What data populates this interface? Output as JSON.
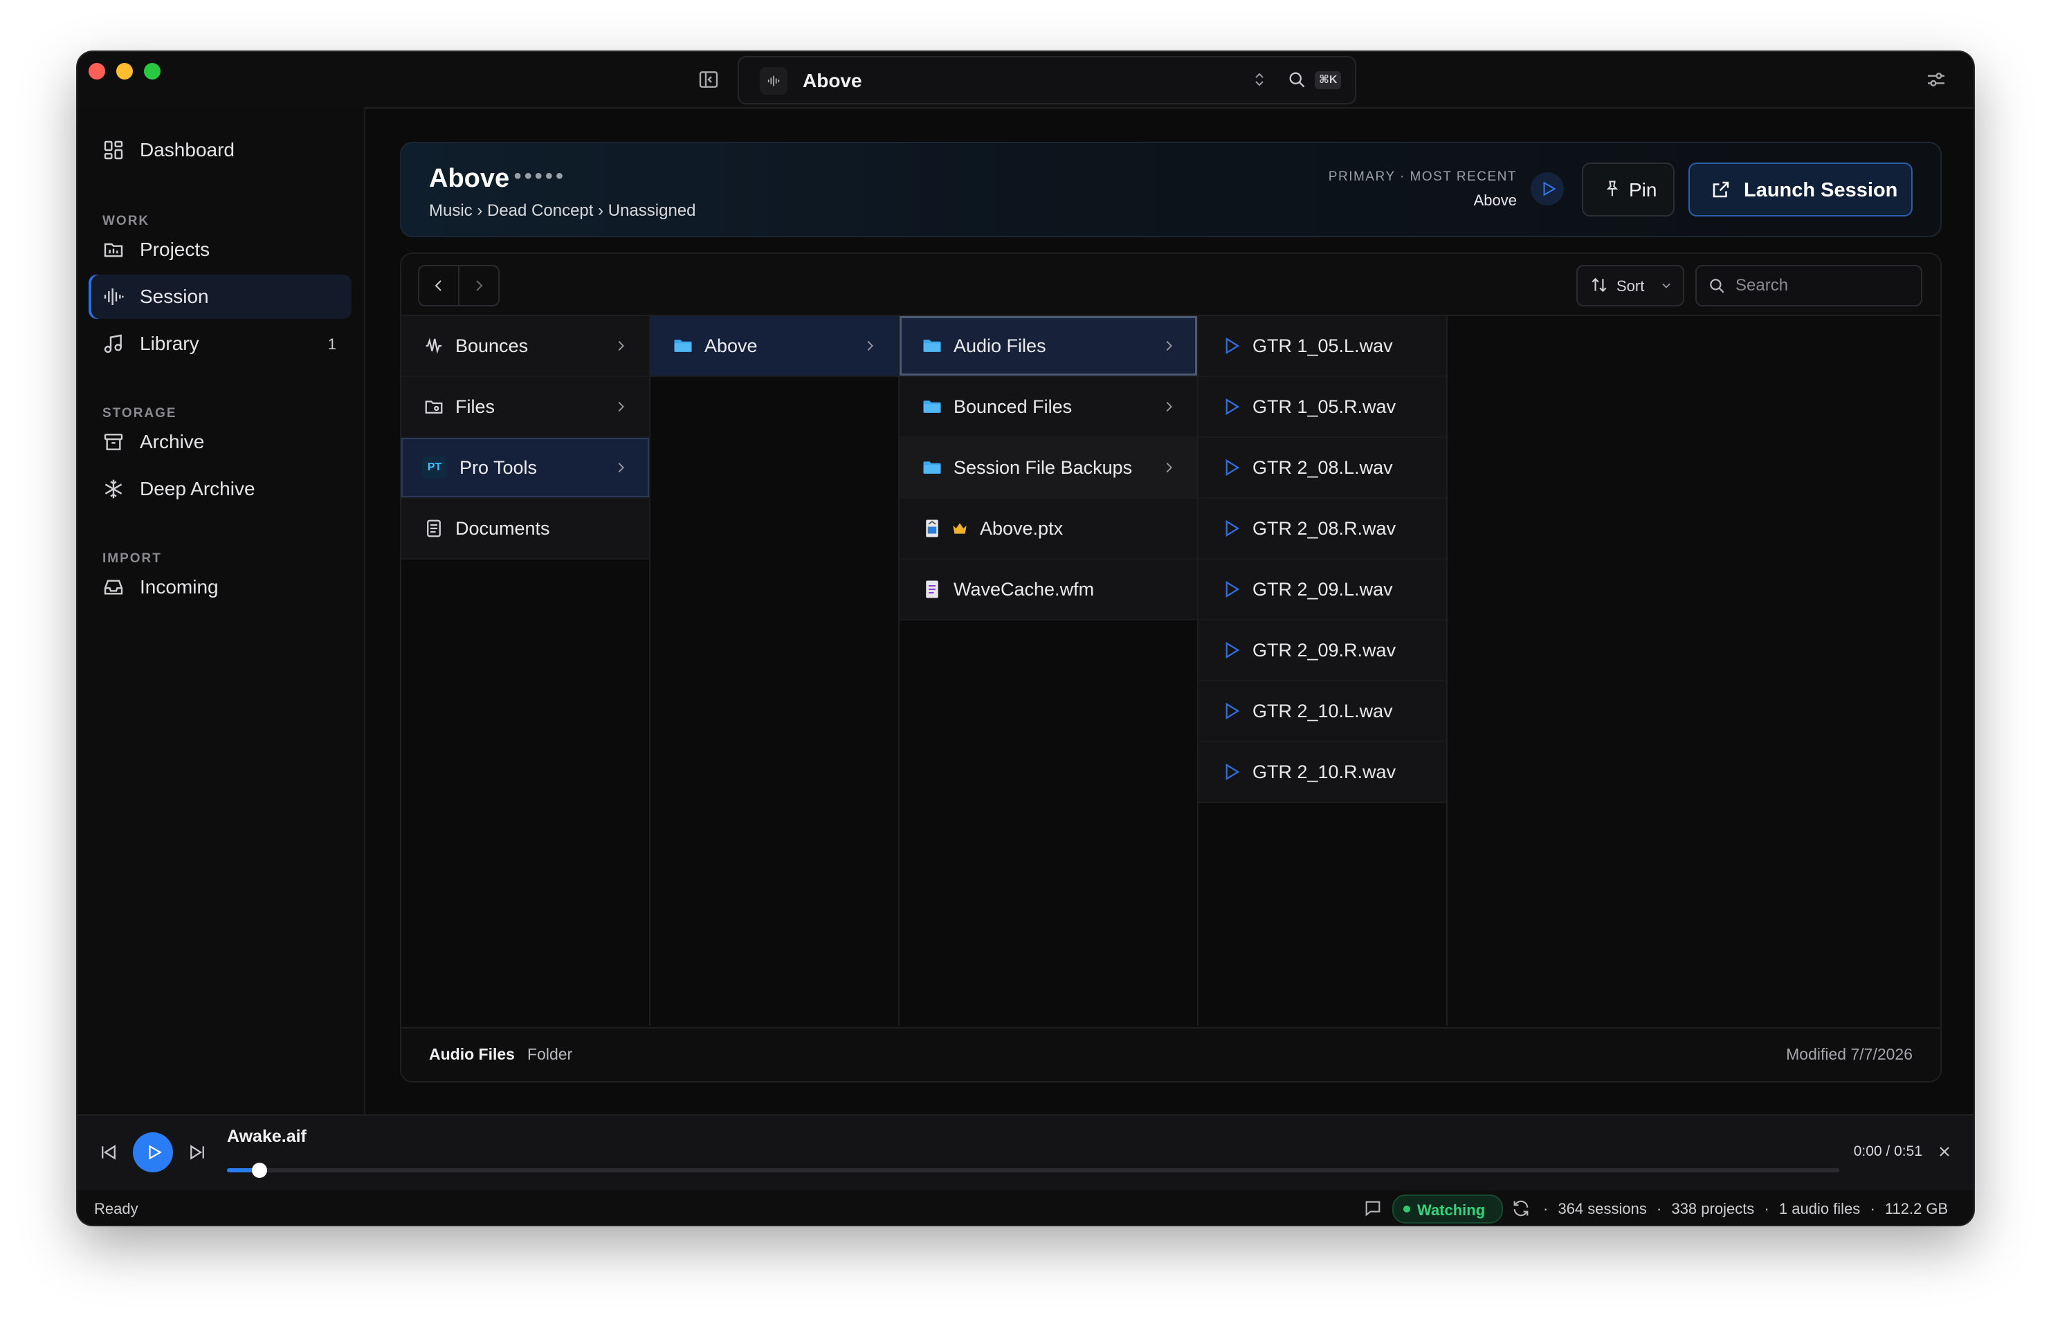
{
  "window": {
    "traffic_colors": [
      "#ff5f57",
      "#febc2e",
      "#28c840"
    ]
  },
  "titlebar": {
    "current_title": "Above",
    "shortcut": "⌘K",
    "app_icon": "waveform-icon"
  },
  "sidebar": {
    "dashboard": "Dashboard",
    "sections": {
      "work": "WORK",
      "storage": "STORAGE",
      "import": "IMPORT"
    },
    "projects": "Projects",
    "session": "Session",
    "library": "Library",
    "library_count": "1",
    "archive": "Archive",
    "deep_archive": "Deep Archive",
    "incoming": "Incoming"
  },
  "header": {
    "title": "Above",
    "dots": "●●●●●",
    "breadcrumb": "Music › Dead Concept › Unassigned",
    "primary_label": "PRIMARY · MOST RECENT",
    "primary_name": "Above",
    "pin_label": "Pin",
    "launch_label": "Launch Session"
  },
  "browser": {
    "sort_label": "Sort",
    "search_placeholder": "Search",
    "col1": [
      {
        "label": "Bounces",
        "icon": "waveform-icon"
      },
      {
        "label": "Files",
        "icon": "folder-outline-icon"
      },
      {
        "label": "Pro Tools",
        "icon": "pt-badge",
        "badge": "PT"
      },
      {
        "label": "Documents",
        "icon": "document-icon"
      }
    ],
    "col2": [
      {
        "label": "Above",
        "icon": "folder-icon"
      }
    ],
    "col3": [
      {
        "label": "Audio Files",
        "icon": "folder-icon"
      },
      {
        "label": "Bounced Files",
        "icon": "folder-icon"
      },
      {
        "label": "Session File Backups",
        "icon": "folder-icon"
      },
      {
        "label": "Above.ptx",
        "icon": "ptx-file-icon"
      },
      {
        "label": "WaveCache.wfm",
        "icon": "wfm-file-icon"
      }
    ],
    "col4": [
      "GTR 1_05.L.wav",
      "GTR 1_05.R.wav",
      "GTR 2_08.L.wav",
      "GTR 2_08.R.wav",
      "GTR 2_09.L.wav",
      "GTR 2_09.R.wav",
      "GTR 2_10.L.wav",
      "GTR 2_10.R.wav"
    ],
    "status": {
      "name": "Audio Files",
      "type": "Folder",
      "modified": "Modified 7/7/2026"
    }
  },
  "player": {
    "file": "Awake.aif",
    "time": "0:00 / 0:51",
    "progress": 0.02
  },
  "statusbar": {
    "ready": "Ready",
    "watching": "Watching",
    "sessions": "364 sessions",
    "projects": "338 projects",
    "audio_files": "1 audio files",
    "size": "112.2 GB",
    "separator": "·"
  },
  "colors": {
    "accent": "#2a7df4",
    "folder": "#3aa9ee",
    "watching": "#36d37f"
  }
}
